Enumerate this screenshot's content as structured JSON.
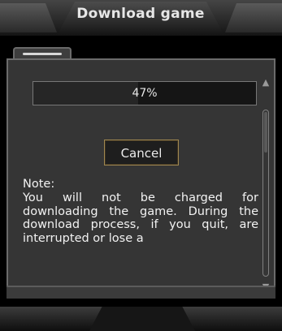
{
  "window": {
    "title": "Download game"
  },
  "progress": {
    "text": "47%",
    "value": 0.47
  },
  "actions": {
    "cancel_label": "Cancel"
  },
  "note": {
    "heading": "Note:",
    "body": "You will not be charged for downloading the game. During the download process, if you quit, are interrupted or lose a"
  },
  "scrollbar": {
    "up_icon": "arrow-up-icon",
    "down_icon": "arrow-down-icon"
  },
  "colors": {
    "button_border": "#a08850",
    "panel_bg": "#353535"
  }
}
